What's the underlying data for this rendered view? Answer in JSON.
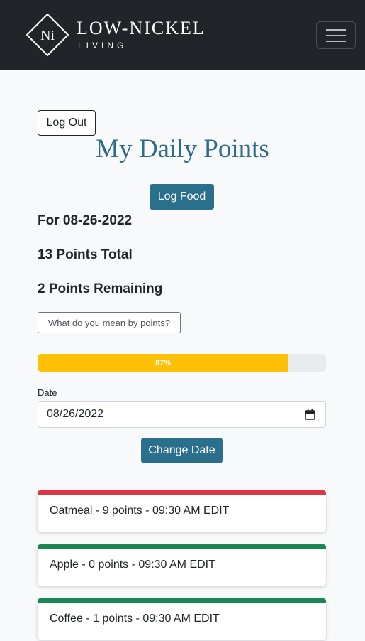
{
  "brand": {
    "mark": "Ni",
    "title": "LOW-NICKEL",
    "subtitle": "LIVING"
  },
  "nav": {
    "menu_icon": "hamburger-icon"
  },
  "header": {
    "logout_label": "Log Out",
    "title": "My Daily Points",
    "log_food_label": "Log Food"
  },
  "summary": {
    "date_line": "For 08-26-2022",
    "total_line": "13 Points Total",
    "remaining_line": "2 Points Remaining",
    "help_button": "What do you mean by points?"
  },
  "progress": {
    "value_percent": 87,
    "label": "87%",
    "color": "#ffc107"
  },
  "date_form": {
    "label": "Date",
    "value": "08/26/2022",
    "icon": "calendar-icon",
    "submit_label": "Change Date"
  },
  "entries": [
    {
      "text": "Oatmeal - 9 points - 09:30 AM EDIT",
      "status_color": "#dc3545"
    },
    {
      "text": "Apple - 0 points - 09:30 AM EDIT",
      "status_color": "#198754"
    },
    {
      "text": "Coffee - 1 points - 09:30 AM EDIT",
      "status_color": "#198754"
    }
  ],
  "colors": {
    "navbar": "#212529",
    "primary": "#2a6f8c",
    "title": "#2e6b88"
  }
}
